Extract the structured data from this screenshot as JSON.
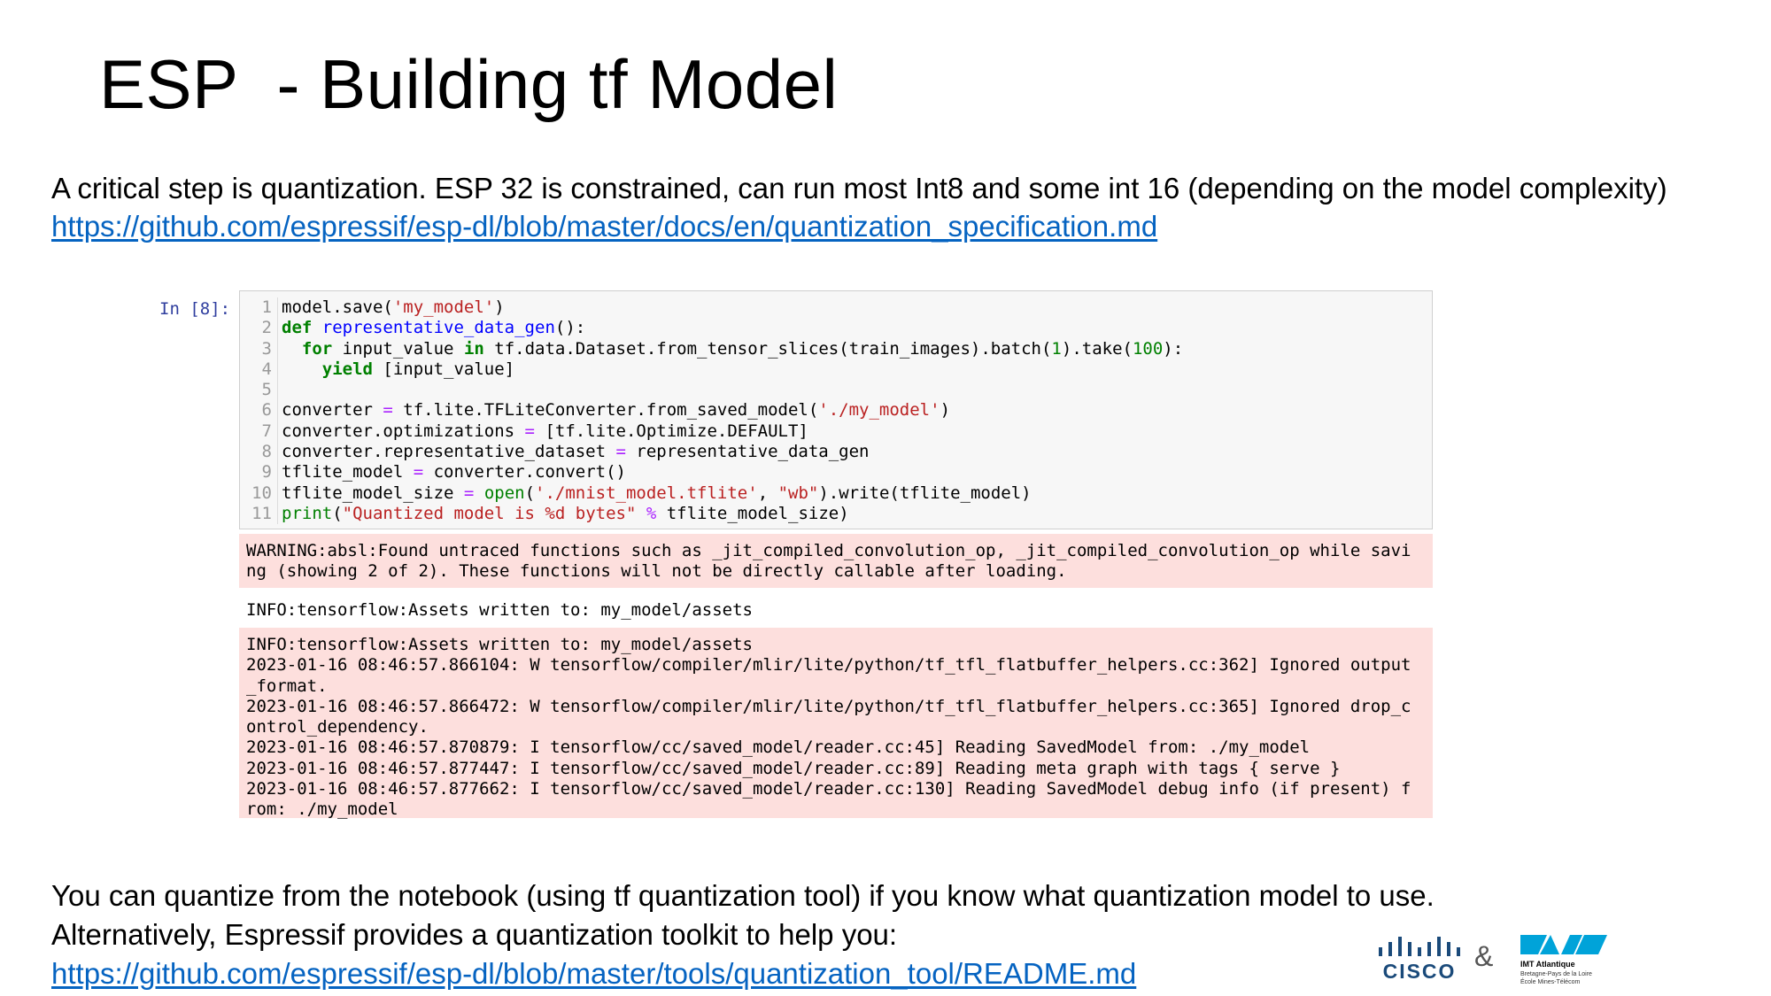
{
  "slide": {
    "title": "ESP  - Building tf Model",
    "intro_text": "A critical step is quantization. ESP 32 is constrained, can run most Int8 and some int 16 (depending on the model complexity)",
    "intro_link": "https://github.com/espressif/esp-dl/blob/master/docs/en/quantization_specification.md",
    "outro_line1": "You can quantize from the notebook (using tf quantization tool) if you know what quantization model to use.",
    "outro_line2": "Alternatively, Espressif provides a quantization toolkit to help you:",
    "outro_link": "https://github.com/espressif/esp-dl/blob/master/tools/quantization_tool/README.md"
  },
  "notebook": {
    "prompt": "In [8]:",
    "line_numbers": [
      "1",
      "2",
      "3",
      "4",
      "5",
      "6",
      "7",
      "8",
      "9",
      "10",
      "11"
    ],
    "code": {
      "l1": [
        "model.save(",
        "'my_model'",
        ")"
      ],
      "l2": [
        "def",
        " ",
        "representative_data_gen",
        "():"
      ],
      "l3": [
        "  ",
        "for",
        " input_value ",
        "in",
        " tf.data.Dataset.from_tensor_slices(train_images).batch(",
        "1",
        ").take(",
        "100",
        "):"
      ],
      "l4": [
        "    ",
        "yield",
        " [input_value]"
      ],
      "l6": [
        "converter ",
        "=",
        " tf.lite.TFLiteConverter.from_saved_model(",
        "'./my_model'",
        ")"
      ],
      "l7": [
        "converter.optimizations ",
        "=",
        " [tf.lite.Optimize.DEFAULT]"
      ],
      "l8": [
        "converter.representative_dataset ",
        "=",
        " representative_data_gen"
      ],
      "l9": [
        "tflite_model ",
        "=",
        " converter.convert()"
      ],
      "l10": [
        "tflite_model_size ",
        "=",
        " ",
        "open",
        "(",
        "'./mnist_model.tflite'",
        ", ",
        "\"wb\"",
        ").write(tflite_model)"
      ],
      "l11": [
        "print",
        "(",
        "\"Quantized model is %d bytes\"",
        " ",
        "%",
        " tflite_model_size)"
      ]
    },
    "output_warning": "WARNING:absl:Found untraced functions such as _jit_compiled_convolution_op, _jit_compiled_convolution_op while savi\nng (showing 2 of 2). These functions will not be directly callable after loading.",
    "output_info": "INFO:tensorflow:Assets written to: my_model/assets",
    "output_log": "INFO:tensorflow:Assets written to: my_model/assets\n2023-01-16 08:46:57.866104: W tensorflow/compiler/mlir/lite/python/tf_tfl_flatbuffer_helpers.cc:362] Ignored output\n_format.\n2023-01-16 08:46:57.866472: W tensorflow/compiler/mlir/lite/python/tf_tfl_flatbuffer_helpers.cc:365] Ignored drop_c\nontrol_dependency.\n2023-01-16 08:46:57.870879: I tensorflow/cc/saved_model/reader.cc:45] Reading SavedModel from: ./my_model\n2023-01-16 08:46:57.877447: I tensorflow/cc/saved_model/reader.cc:89] Reading meta graph with tags { serve }\n2023-01-16 08:46:57.877662: I tensorflow/cc/saved_model/reader.cc:130] Reading SavedModel debug info (if present) f\nrom: ./my_model"
  },
  "logos": {
    "cisco_text": "CISCO",
    "ampersand": "&",
    "imt_name": "IMT Atlantique",
    "imt_sub1": "Bretagne-Pays de la Loire",
    "imt_sub2": "École Mines-Télécom",
    "cisco_color": "#1a4a7a",
    "imt_color": "#00a3d9"
  }
}
